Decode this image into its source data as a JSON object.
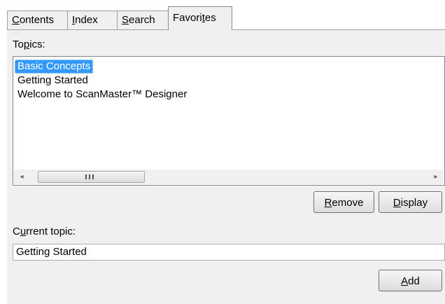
{
  "tabs": [
    {
      "pre": "",
      "key": "C",
      "post": "ontents"
    },
    {
      "pre": "",
      "key": "I",
      "post": "ndex"
    },
    {
      "pre": "",
      "key": "S",
      "post": "earch"
    },
    {
      "pre": "Favori",
      "key": "t",
      "post": "es"
    }
  ],
  "active_tab": "Favorites",
  "topics_label": {
    "pre": "To",
    "key": "p",
    "post": "ics:"
  },
  "topics": [
    {
      "text": "Basic Concepts",
      "selected": true
    },
    {
      "text": "Getting Started",
      "selected": false
    },
    {
      "text": "Welcome to ScanMaster™ Designer",
      "selected": false
    }
  ],
  "scrollbar": {
    "left_arrow": "◂",
    "right_arrow": "▸",
    "icons": [
      "scroll-left-arrow-icon",
      "scroll-right-arrow-icon",
      "scroll-grip-icon"
    ]
  },
  "buttons": {
    "remove": {
      "pre": "",
      "key": "R",
      "post": "emove"
    },
    "display": {
      "pre": "",
      "key": "D",
      "post": "isplay"
    },
    "add": {
      "pre": "",
      "key": "A",
      "post": "dd"
    }
  },
  "current_topic_label": {
    "pre": "C",
    "key": "u",
    "post": "rrent topic:"
  },
  "current_topic_value": "Getting Started",
  "colors": {
    "selection": "#3399ff",
    "panel": "#f0f0f0"
  }
}
